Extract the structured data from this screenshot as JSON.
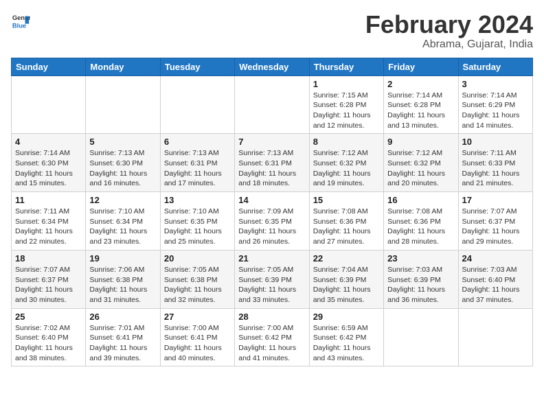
{
  "header": {
    "logo_general": "General",
    "logo_blue": "Blue",
    "month_year": "February 2024",
    "location": "Abrama, Gujarat, India"
  },
  "weekdays": [
    "Sunday",
    "Monday",
    "Tuesday",
    "Wednesday",
    "Thursday",
    "Friday",
    "Saturday"
  ],
  "weeks": [
    [
      {
        "day": "",
        "sunrise": "",
        "sunset": "",
        "daylight": ""
      },
      {
        "day": "",
        "sunrise": "",
        "sunset": "",
        "daylight": ""
      },
      {
        "day": "",
        "sunrise": "",
        "sunset": "",
        "daylight": ""
      },
      {
        "day": "",
        "sunrise": "",
        "sunset": "",
        "daylight": ""
      },
      {
        "day": "1",
        "sunrise": "Sunrise: 7:15 AM",
        "sunset": "Sunset: 6:28 PM",
        "daylight": "Daylight: 11 hours and 12 minutes."
      },
      {
        "day": "2",
        "sunrise": "Sunrise: 7:14 AM",
        "sunset": "Sunset: 6:28 PM",
        "daylight": "Daylight: 11 hours and 13 minutes."
      },
      {
        "day": "3",
        "sunrise": "Sunrise: 7:14 AM",
        "sunset": "Sunset: 6:29 PM",
        "daylight": "Daylight: 11 hours and 14 minutes."
      }
    ],
    [
      {
        "day": "4",
        "sunrise": "Sunrise: 7:14 AM",
        "sunset": "Sunset: 6:30 PM",
        "daylight": "Daylight: 11 hours and 15 minutes."
      },
      {
        "day": "5",
        "sunrise": "Sunrise: 7:13 AM",
        "sunset": "Sunset: 6:30 PM",
        "daylight": "Daylight: 11 hours and 16 minutes."
      },
      {
        "day": "6",
        "sunrise": "Sunrise: 7:13 AM",
        "sunset": "Sunset: 6:31 PM",
        "daylight": "Daylight: 11 hours and 17 minutes."
      },
      {
        "day": "7",
        "sunrise": "Sunrise: 7:13 AM",
        "sunset": "Sunset: 6:31 PM",
        "daylight": "Daylight: 11 hours and 18 minutes."
      },
      {
        "day": "8",
        "sunrise": "Sunrise: 7:12 AM",
        "sunset": "Sunset: 6:32 PM",
        "daylight": "Daylight: 11 hours and 19 minutes."
      },
      {
        "day": "9",
        "sunrise": "Sunrise: 7:12 AM",
        "sunset": "Sunset: 6:32 PM",
        "daylight": "Daylight: 11 hours and 20 minutes."
      },
      {
        "day": "10",
        "sunrise": "Sunrise: 7:11 AM",
        "sunset": "Sunset: 6:33 PM",
        "daylight": "Daylight: 11 hours and 21 minutes."
      }
    ],
    [
      {
        "day": "11",
        "sunrise": "Sunrise: 7:11 AM",
        "sunset": "Sunset: 6:34 PM",
        "daylight": "Daylight: 11 hours and 22 minutes."
      },
      {
        "day": "12",
        "sunrise": "Sunrise: 7:10 AM",
        "sunset": "Sunset: 6:34 PM",
        "daylight": "Daylight: 11 hours and 23 minutes."
      },
      {
        "day": "13",
        "sunrise": "Sunrise: 7:10 AM",
        "sunset": "Sunset: 6:35 PM",
        "daylight": "Daylight: 11 hours and 25 minutes."
      },
      {
        "day": "14",
        "sunrise": "Sunrise: 7:09 AM",
        "sunset": "Sunset: 6:35 PM",
        "daylight": "Daylight: 11 hours and 26 minutes."
      },
      {
        "day": "15",
        "sunrise": "Sunrise: 7:08 AM",
        "sunset": "Sunset: 6:36 PM",
        "daylight": "Daylight: 11 hours and 27 minutes."
      },
      {
        "day": "16",
        "sunrise": "Sunrise: 7:08 AM",
        "sunset": "Sunset: 6:36 PM",
        "daylight": "Daylight: 11 hours and 28 minutes."
      },
      {
        "day": "17",
        "sunrise": "Sunrise: 7:07 AM",
        "sunset": "Sunset: 6:37 PM",
        "daylight": "Daylight: 11 hours and 29 minutes."
      }
    ],
    [
      {
        "day": "18",
        "sunrise": "Sunrise: 7:07 AM",
        "sunset": "Sunset: 6:37 PM",
        "daylight": "Daylight: 11 hours and 30 minutes."
      },
      {
        "day": "19",
        "sunrise": "Sunrise: 7:06 AM",
        "sunset": "Sunset: 6:38 PM",
        "daylight": "Daylight: 11 hours and 31 minutes."
      },
      {
        "day": "20",
        "sunrise": "Sunrise: 7:05 AM",
        "sunset": "Sunset: 6:38 PM",
        "daylight": "Daylight: 11 hours and 32 minutes."
      },
      {
        "day": "21",
        "sunrise": "Sunrise: 7:05 AM",
        "sunset": "Sunset: 6:39 PM",
        "daylight": "Daylight: 11 hours and 33 minutes."
      },
      {
        "day": "22",
        "sunrise": "Sunrise: 7:04 AM",
        "sunset": "Sunset: 6:39 PM",
        "daylight": "Daylight: 11 hours and 35 minutes."
      },
      {
        "day": "23",
        "sunrise": "Sunrise: 7:03 AM",
        "sunset": "Sunset: 6:39 PM",
        "daylight": "Daylight: 11 hours and 36 minutes."
      },
      {
        "day": "24",
        "sunrise": "Sunrise: 7:03 AM",
        "sunset": "Sunset: 6:40 PM",
        "daylight": "Daylight: 11 hours and 37 minutes."
      }
    ],
    [
      {
        "day": "25",
        "sunrise": "Sunrise: 7:02 AM",
        "sunset": "Sunset: 6:40 PM",
        "daylight": "Daylight: 11 hours and 38 minutes."
      },
      {
        "day": "26",
        "sunrise": "Sunrise: 7:01 AM",
        "sunset": "Sunset: 6:41 PM",
        "daylight": "Daylight: 11 hours and 39 minutes."
      },
      {
        "day": "27",
        "sunrise": "Sunrise: 7:00 AM",
        "sunset": "Sunset: 6:41 PM",
        "daylight": "Daylight: 11 hours and 40 minutes."
      },
      {
        "day": "28",
        "sunrise": "Sunrise: 7:00 AM",
        "sunset": "Sunset: 6:42 PM",
        "daylight": "Daylight: 11 hours and 41 minutes."
      },
      {
        "day": "29",
        "sunrise": "Sunrise: 6:59 AM",
        "sunset": "Sunset: 6:42 PM",
        "daylight": "Daylight: 11 hours and 43 minutes."
      },
      {
        "day": "",
        "sunrise": "",
        "sunset": "",
        "daylight": ""
      },
      {
        "day": "",
        "sunrise": "",
        "sunset": "",
        "daylight": ""
      }
    ]
  ]
}
